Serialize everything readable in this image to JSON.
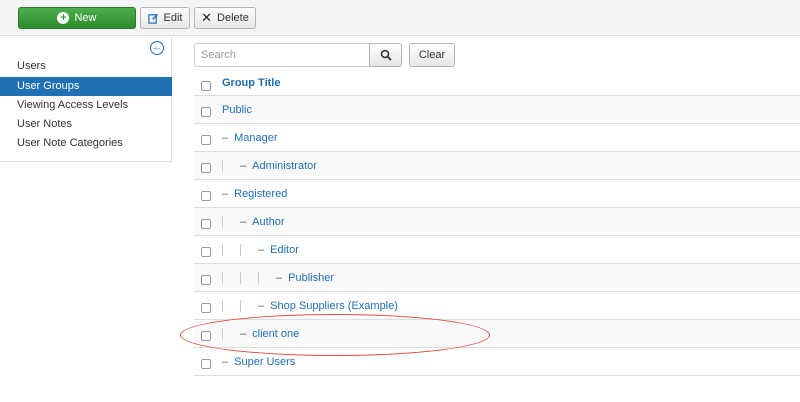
{
  "toolbar": {
    "new_label": "New",
    "edit_label": "Edit",
    "delete_label": "Delete"
  },
  "sidebar": {
    "items": [
      {
        "label": "Users",
        "active": false
      },
      {
        "label": "User Groups",
        "active": true
      },
      {
        "label": "Viewing Access Levels",
        "active": false
      },
      {
        "label": "User Notes",
        "active": false
      },
      {
        "label": "User Note Categories",
        "active": false
      }
    ]
  },
  "search": {
    "placeholder": "Search",
    "value": "",
    "clear_label": "Clear"
  },
  "table": {
    "header_title": "Group Title",
    "rows": [
      {
        "title": "Public",
        "level": 0
      },
      {
        "title": "Manager",
        "level": 1
      },
      {
        "title": "Administrator",
        "level": 2
      },
      {
        "title": "Registered",
        "level": 1
      },
      {
        "title": "Author",
        "level": 2
      },
      {
        "title": "Editor",
        "level": 3
      },
      {
        "title": "Publisher",
        "level": 4
      },
      {
        "title": "Shop Suppliers (Example)",
        "level": 3
      },
      {
        "title": "client one",
        "level": 2
      },
      {
        "title": "Super Users",
        "level": 1
      }
    ]
  },
  "colors": {
    "accent": "#1f6eb5",
    "new_button": "#3a9c3a",
    "annotation": "#e04a3a"
  }
}
